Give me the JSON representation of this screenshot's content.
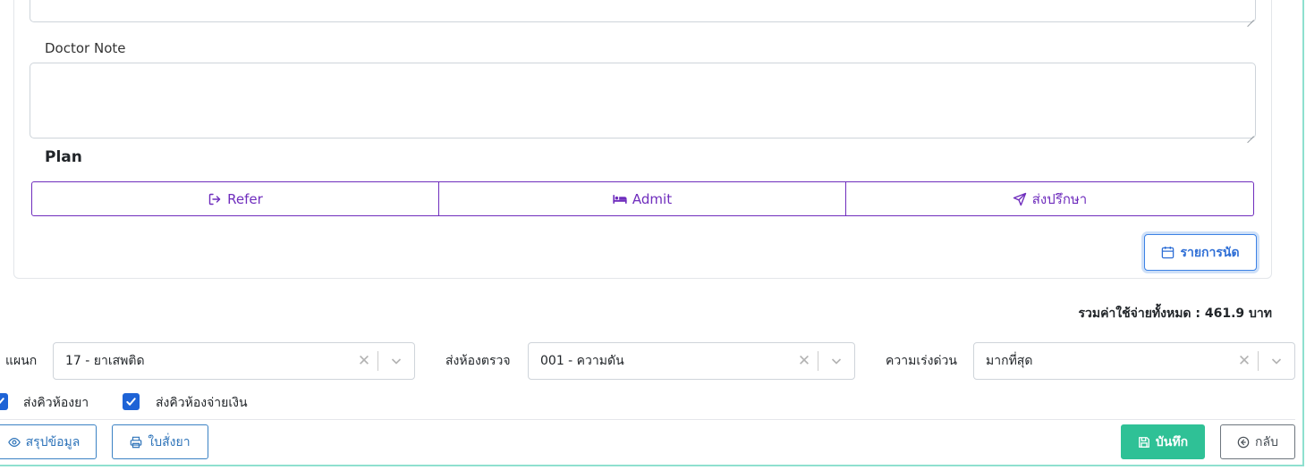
{
  "doctor_note": {
    "label": "Doctor Note",
    "value": ""
  },
  "plan": {
    "heading": "Plan",
    "buttons": {
      "refer": "Refer",
      "admit": "Admit",
      "consult": "ส่งปรึกษา"
    },
    "appointments_label": "รายการนัด"
  },
  "total": {
    "text": "รวมค่าใช้จ่ายทั้งหมด : 461.9 บาท"
  },
  "filters": {
    "department": {
      "label": "แผนก",
      "value": "17 - ยาเสพติด"
    },
    "exam_room": {
      "label": "ส่งห้องตรวจ",
      "value": "001 - ความดัน"
    },
    "urgency": {
      "label": "ความเร่งด่วน",
      "value": "มากที่สุด"
    }
  },
  "checkboxes": {
    "pharmacy_queue": {
      "label": "ส่งคิวห้องยา",
      "checked": true
    },
    "payment_queue": {
      "label": "ส่งคิวห้องจ่ายเงิน",
      "checked": true
    }
  },
  "actions": {
    "summary": "สรุปข้อมูล",
    "prescription": "ใบสั่งยา",
    "save": "บันทึก",
    "back": "กลับ"
  },
  "colors": {
    "plan_accent": "#6f2dbd",
    "primary": "#3d82e5",
    "success": "#2fc196",
    "checkbox": "#1e63d6"
  },
  "icons": {
    "refer": "sign-out-icon",
    "admit": "bed-icon",
    "consult": "paper-plane-icon",
    "appointments": "calendar-icon",
    "summary": "eye-icon",
    "prescription": "printer-icon",
    "save": "floppy-disk-icon",
    "back": "arrow-circle-left-icon"
  }
}
